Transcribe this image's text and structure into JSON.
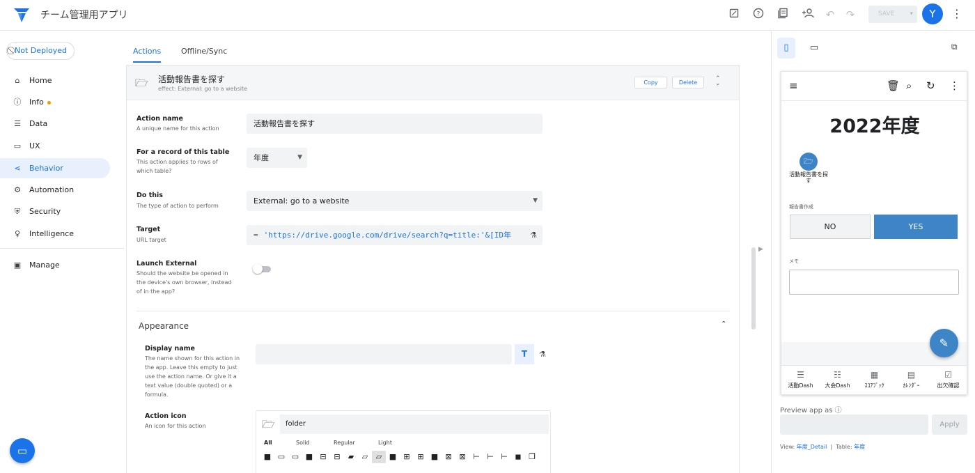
{
  "header": {
    "app_title": "チーム管理用アプリ",
    "save_label": "SAVE",
    "avatar_initial": "Y",
    "icons": [
      "preview-toggle-icon",
      "help-icon",
      "docs-icon",
      "share-person-add-icon",
      "undo-icon",
      "redo-icon",
      "more-vert-icon"
    ]
  },
  "sidebar": {
    "deploy_status": "Not Deployed",
    "items": [
      {
        "label": "Home",
        "icon": "home-icon"
      },
      {
        "label": "Info",
        "icon": "info-icon"
      },
      {
        "label": "Data",
        "icon": "data-icon"
      },
      {
        "label": "UX",
        "icon": "ux-icon"
      },
      {
        "label": "Behavior",
        "icon": "behavior-icon"
      },
      {
        "label": "Automation",
        "icon": "automation-icon"
      },
      {
        "label": "Security",
        "icon": "security-icon"
      },
      {
        "label": "Intelligence",
        "icon": "intelligence-icon"
      },
      {
        "label": "Manage",
        "icon": "manage-icon"
      }
    ],
    "active": "Behavior"
  },
  "tabs": [
    "Actions",
    "Offline/Sync"
  ],
  "action_card": {
    "title": "活動報告書を探す",
    "effect": "effect: External: go to a website",
    "copy_label": "Copy",
    "delete_label": "Delete",
    "action_name": {
      "label": "Action name",
      "desc": "A unique name for this action",
      "value": "活動報告書を探す"
    },
    "record_table": {
      "label": "For a record of this table",
      "desc": "This action applies to rows of which table?",
      "value": "年度"
    },
    "do_this": {
      "label": "Do this",
      "desc": "The type of action to perform",
      "value": "External: go to a website"
    },
    "target": {
      "label": "Target",
      "desc": "URL target",
      "eq": "=",
      "value": "'https://drive.google.com/drive/search?q=title:'&[ID年"
    },
    "launch_external": {
      "label": "Launch External",
      "desc": "Should the website be opened in the device's own browser, instead of in the app?",
      "on": false
    },
    "appearance_title": "Appearance",
    "display_name": {
      "label": "Display name",
      "desc": "The name shown for this action in the app. Leave this empty to just use the action name. Or give it a text value (double quoted) or a formula.",
      "value": "",
      "t_label": "T"
    },
    "action_icon": {
      "label": "Action icon",
      "desc": "An icon for this action",
      "search_value": "folder",
      "filters": [
        "All",
        "Solid",
        "Regular",
        "Light"
      ],
      "selected_filter": "All"
    }
  },
  "preview": {
    "year_title": "2022年度",
    "action_label": "活動報告書を探す",
    "report_label": "報告書作成",
    "no_label": "NO",
    "yes_label": "YES",
    "memo_label": "メモ",
    "nav": [
      {
        "label": "活動Dash",
        "icon": "list-icon"
      },
      {
        "label": "大会Dash",
        "icon": "numbered-list-icon"
      },
      {
        "label": "ｽｺｱﾌﾞｯｸ",
        "icon": "table-icon"
      },
      {
        "label": "ｶﾚﾝﾀﾞｰ",
        "icon": "calendar-icon"
      },
      {
        "label": "出欠確認",
        "icon": "checklist-icon"
      }
    ],
    "preview_as_label": "Preview app as",
    "apply_label": "Apply",
    "view_prefix": "View:",
    "view_value": "年度_Detail",
    "table_prefix": "Table:",
    "table_value": "年度",
    "separator": "|"
  },
  "colors": {
    "accent": "#1a73e8",
    "app_blue": "#3d85c6",
    "active_bg": "#e8f0fe",
    "info_dot": "#f29900"
  }
}
